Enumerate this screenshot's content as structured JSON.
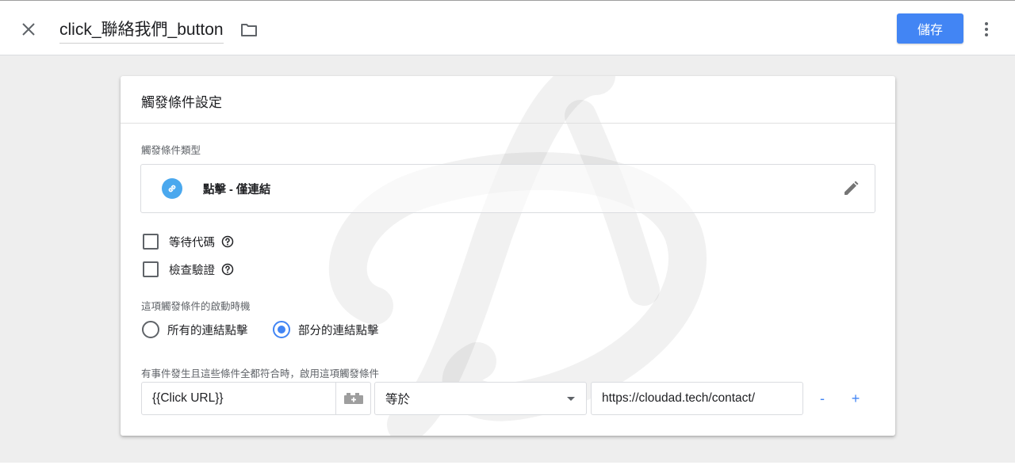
{
  "header": {
    "title": "click_聯絡我們_button",
    "save_label": "儲存",
    "icons": [
      "close-icon",
      "folder-icon",
      "more-vert-icon"
    ]
  },
  "card": {
    "title": "觸發條件設定",
    "trigger_type_label": "觸發條件類型",
    "trigger_type": {
      "name": "點擊 - 僅連結",
      "icon": "link-icon",
      "icon_color": "#4aa8ee"
    },
    "checkboxes": [
      {
        "label": "等待代碼",
        "checked": false
      },
      {
        "label": "檢查驗證",
        "checked": false
      }
    ],
    "fires_on_label": "這項觸發條件的啟動時機",
    "fires_on_options": [
      {
        "label": "所有的連結點擊",
        "selected": false
      },
      {
        "label": "部分的連結點擊",
        "selected": true
      }
    ],
    "condition_label": "有事件發生且這些條件全都符合時，啟用這項觸發條件",
    "condition": {
      "variable": "{{Click URL}}",
      "operator": "等於",
      "value": "https://cloudad.tech/contact/",
      "remove_label": "-",
      "add_label": "+"
    }
  },
  "colors": {
    "accent": "#4285f4",
    "background": "#eeeeee",
    "text": "#202124",
    "secondary_text": "#5f6368"
  }
}
